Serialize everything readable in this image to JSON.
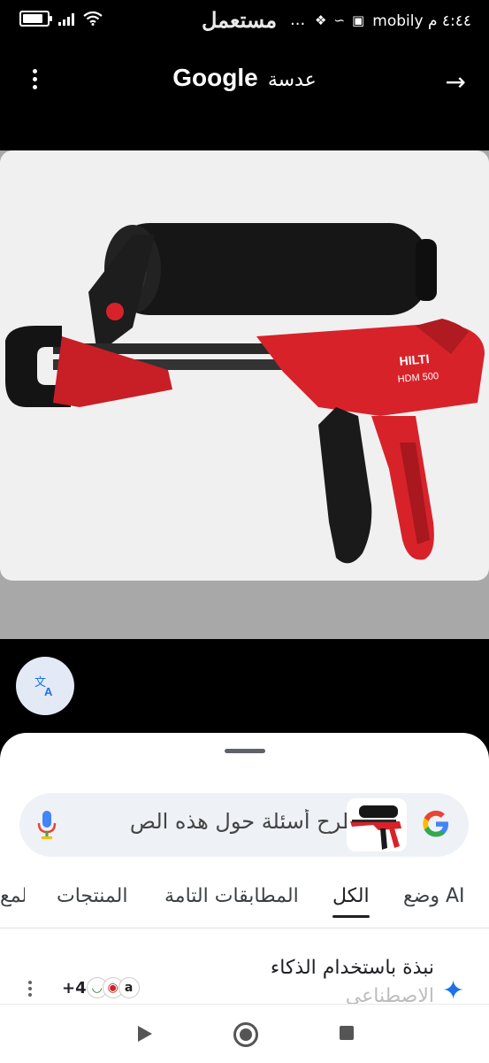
{
  "status_bar": {
    "carrier_time": "mobily ٤:٤٤ م",
    "watermark": "مستعمل",
    "more": "..."
  },
  "header": {
    "google": "Google",
    "title_ar": "عدسة"
  },
  "product": {
    "brand": "HILTI",
    "model": "HDM 500"
  },
  "search": {
    "placeholder": "طرح أسئلة حول هذه الص"
  },
  "tabs": [
    {
      "label": "وضع AI"
    },
    {
      "label": "الكل",
      "active": true
    },
    {
      "label": "المطابقات التامة"
    },
    {
      "label": "المنتجات"
    },
    {
      "label": "المع"
    }
  ],
  "ai_overview": {
    "title_line1": "نبذة باستخدام الذكاء",
    "title_line2": "الاصطناعي",
    "sources_count": "+4"
  },
  "colors": {
    "accent_blue": "#1a73e8",
    "tool_red": "#d8222a"
  }
}
